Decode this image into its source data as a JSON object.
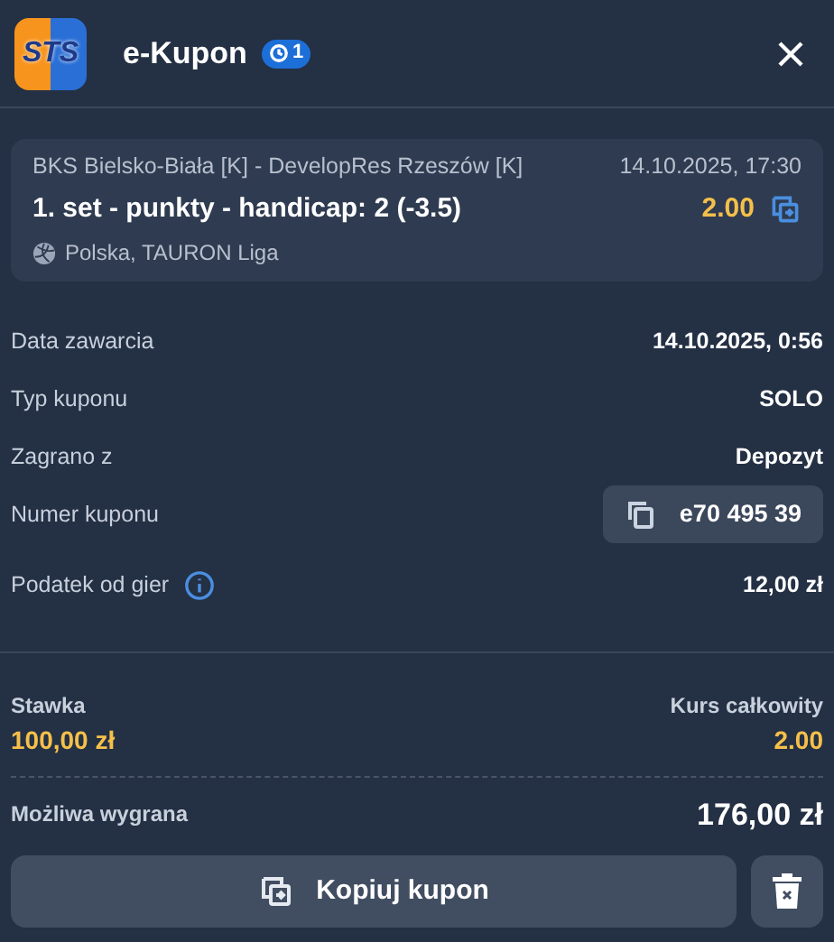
{
  "header": {
    "logo_text": "STS",
    "title": "e-Kupon",
    "badge": "1"
  },
  "bet": {
    "match": "BKS Bielsko-Biała [K] - DevelopRes Rzeszów [K]",
    "datetime": "14.10.2025, 17:30",
    "selection": "1. set - punkty - handicap: 2 (-3.5)",
    "odds": "2.00",
    "league": "Polska, TAURON Liga"
  },
  "details": [
    {
      "kind": "text",
      "label": "Data zawarcia",
      "value": "14.10.2025, 0:56"
    },
    {
      "kind": "text",
      "label": "Typ kuponu",
      "value": "SOLO"
    },
    {
      "kind": "text",
      "label": "Zagrano z",
      "value": "Depozyt"
    },
    {
      "kind": "copy",
      "label": "Numer kuponu",
      "value": "e70 495 39"
    },
    {
      "kind": "info",
      "label": "Podatek od gier",
      "value": "12,00 zł"
    }
  ],
  "summary": {
    "stake_label": "Stawka",
    "stake": "100,00 zł",
    "total_odds_label": "Kurs całkowity",
    "total_odds": "2.00",
    "win_label": "Możliwa wygrana",
    "win": "176,00 zł"
  },
  "buttons": {
    "copy": "Kopiuj kupon"
  }
}
